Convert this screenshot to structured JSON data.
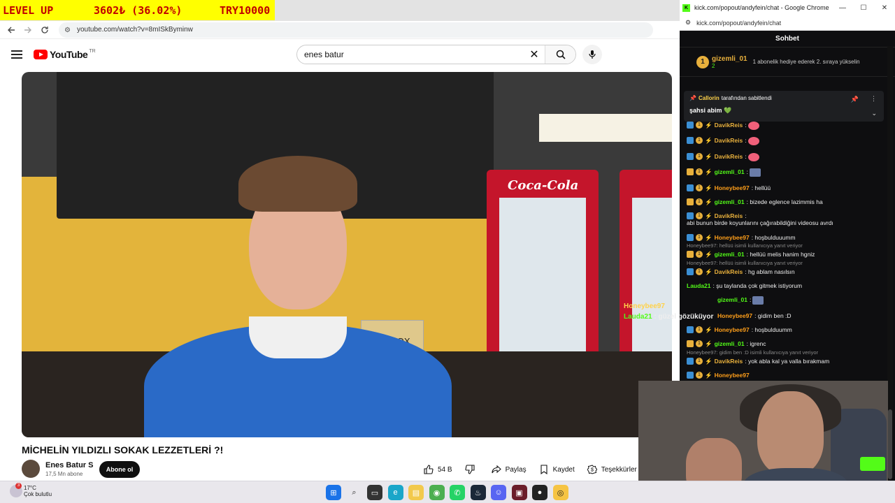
{
  "ticker": {
    "label": "LEVEL UP",
    "value": "3602₺ (36.02%)",
    "target": "TRY10000"
  },
  "browser": {
    "url": "youtube.com/watch?v=8mISkByminw"
  },
  "youtube": {
    "logo_text": "YouTube",
    "country": "TR",
    "search_query": "enes batur",
    "video_title": "MİCHELİN YILDIZLI SOKAK LEZZETLERİ ?!",
    "channel_name": "Enes Batur S",
    "subscribers": "17,5 Mn abone",
    "subscribe_label": "Abone ol",
    "likes": "54 B",
    "share_label": "Paylaş",
    "save_label": "Kaydet",
    "thanks_label": "Teşekkürler",
    "tip_box_text": "TIP BOX",
    "fridge_brand": "Coca-Cola"
  },
  "chat_window": {
    "title": "kick.com/popout/andyfein/chat - Google Chrome",
    "url": "kick.com/popout/andyfein/chat",
    "header": "Sohbet",
    "gift": {
      "rank": "1",
      "user": "gizemli_01",
      "count": "2",
      "message": "1 abonelik hediye ederek 2. sıraya yükselin"
    },
    "pinned": {
      "by_user": "Callorin",
      "by_text": "tarafından sabitlendi",
      "text": "şahsi abim 💚"
    },
    "messages": [
      {
        "user": "DavikReis",
        "color": "#e8b03c",
        "text": "",
        "emote": true,
        "badge": "blue"
      },
      {
        "user": "DavikReis",
        "color": "#e8b03c",
        "text": "",
        "emote": true,
        "badge": "blue"
      },
      {
        "user": "DavikReis",
        "color": "#e8b03c",
        "text": "",
        "emote": true,
        "badge": "blue"
      },
      {
        "user": "gizemli_01",
        "color": "#53fc18",
        "text": "",
        "emote": true,
        "badge": "crown"
      },
      {
        "user": "Honeybee97",
        "color": "#ff9f1a",
        "text": "hellüü",
        "badge": "blue"
      },
      {
        "user": "gizemli_01",
        "color": "#53fc18",
        "text": "bizede eglence lazimmis ha",
        "badge": "crown"
      },
      {
        "user": "DavikReis",
        "color": "#e8b03c",
        "text": "abi bunun birde koyunlarını çağırabildiğini videosu avrdı",
        "badge": "blue"
      },
      {
        "user": "Honeybee97",
        "color": "#ff9f1a",
        "text": "hoşbulduuumm",
        "badge": "blue"
      }
    ],
    "reply1": "Honeybee97: hellüü isimli kullanıcıya yanıt veriyor",
    "msg_gizemli_hellu": {
      "user": "gizemli_01",
      "text": "hellüü melis hanim hgniz"
    },
    "reply2": "Honeybee97: hellüü isimli kullanıcıya yanıt veriyor",
    "msg_davik_abla": {
      "user": "DavikReis",
      "text": "hg ablam nasılsın"
    },
    "msg_lauda": {
      "user": "Lauda21",
      "text": "şu taylanda çok gitmek istiyorum"
    },
    "msg_gizemli_emote": {
      "user": "gizemli_01"
    },
    "msg_honey_gidim": {
      "user": "Honeybee97",
      "text": "gidim ben :D"
    },
    "msg_honey_hos": {
      "user": "Honeybee97",
      "text": "hoşbulduumm"
    },
    "msg_gizemli_igrenc": {
      "user": "gizemli_01",
      "text": "igrenc"
    },
    "reply3": "Honeybee97: gidim ben :D isimli kullanıcıya yanıt veriyor",
    "msg_davik_yok": {
      "user": "DavikReis",
      "text": "yok abla kal ya valla bırakmam"
    },
    "msg_honey_partial": {
      "user": "Honeybee97",
      "text": ""
    }
  },
  "overlay_chat": {
    "line1_user": "Honeybee97",
    "line2_user": "Lauda21",
    "line2_text": "güzel gözüküyor"
  },
  "taskbar": {
    "temperature": "17°C",
    "condition": "Çok bulutlu",
    "notification_count": "3"
  }
}
